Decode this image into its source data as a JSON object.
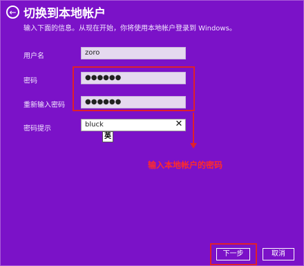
{
  "header": {
    "title": "切换到本地帐户",
    "subtitle": "输入下面的信息。从现在开始，你将使用本地帐户登录到 Windows。"
  },
  "form": {
    "username": {
      "label": "用户名",
      "value": "zoro"
    },
    "password": {
      "label": "密码",
      "value": "●●●●●●"
    },
    "password_confirm": {
      "label": "重新输入密码",
      "value": "●●●●●●"
    },
    "password_hint": {
      "label": "密码提示",
      "value": "bluck"
    }
  },
  "ime_indicator": "英",
  "annotation": "输入本地帐户的密码",
  "buttons": {
    "next": "下一步",
    "cancel": "取消"
  },
  "icons": {
    "back": "back-arrow-icon",
    "clear": "close-icon"
  },
  "colors": {
    "background": "#7b12c8",
    "annotation": "#e0202a"
  }
}
